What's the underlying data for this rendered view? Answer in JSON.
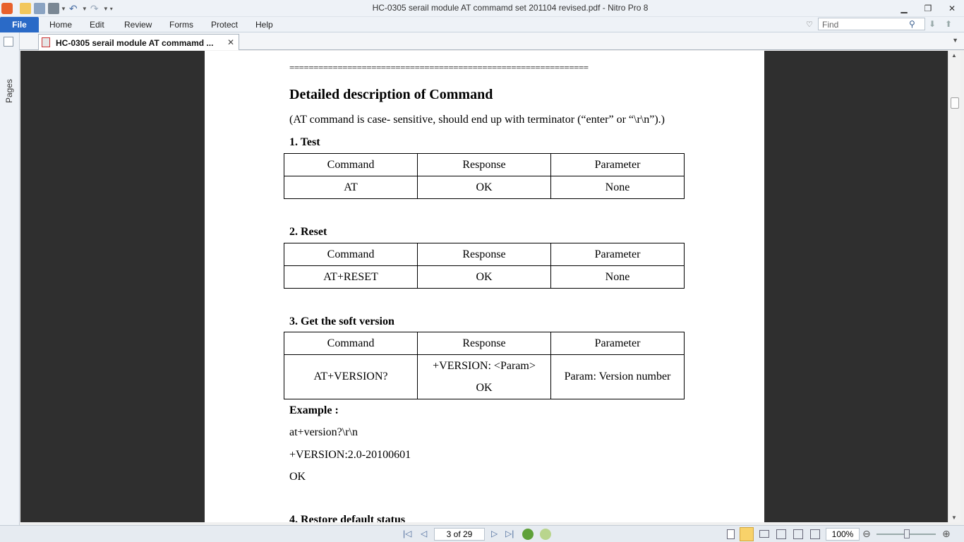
{
  "window": {
    "title": "HC-0305 serail module AT commamd set 201104 revised.pdf - Nitro Pro 8"
  },
  "menu": {
    "file": "File",
    "items": [
      "Home",
      "Edit",
      "Review",
      "Forms",
      "Protect",
      "Help"
    ]
  },
  "find": {
    "placeholder": "Find"
  },
  "tab": {
    "label": "HC-0305 serail module AT commamd ..."
  },
  "sidebar": {
    "pages_label": "Pages"
  },
  "document": {
    "rule": "==============================================================",
    "heading": "Detailed description of Command",
    "note": "(AT command is case- sensitive, should end up with terminator (“enter” or “\\r\\n”).)",
    "sections": [
      {
        "title": "1. Test",
        "headers": [
          "Command",
          "Response",
          "Parameter"
        ],
        "row": [
          "AT",
          "OK",
          "None"
        ]
      },
      {
        "title": "2. Reset",
        "headers": [
          "Command",
          "Response",
          "Parameter"
        ],
        "row": [
          "AT+RESET",
          "OK",
          "None"
        ]
      },
      {
        "title": "3. Get the soft version",
        "headers": [
          "Command",
          "Response",
          "Parameter"
        ],
        "row": [
          "AT+VERSION?",
          "+VERSION: <Param>",
          "Param: Version number"
        ],
        "row_extra": "OK"
      }
    ],
    "example_label": "Example :",
    "example_lines": [
      "at+version?\\r\\n",
      "+VERSION:2.0-20100601",
      "OK"
    ],
    "next_section": "4. Restore default status"
  },
  "status": {
    "page_indicator": "3 of 29",
    "zoom": "100%"
  },
  "colors": {
    "file_button": "#2a6ac7",
    "viewer_bg": "#2f2f2f"
  }
}
